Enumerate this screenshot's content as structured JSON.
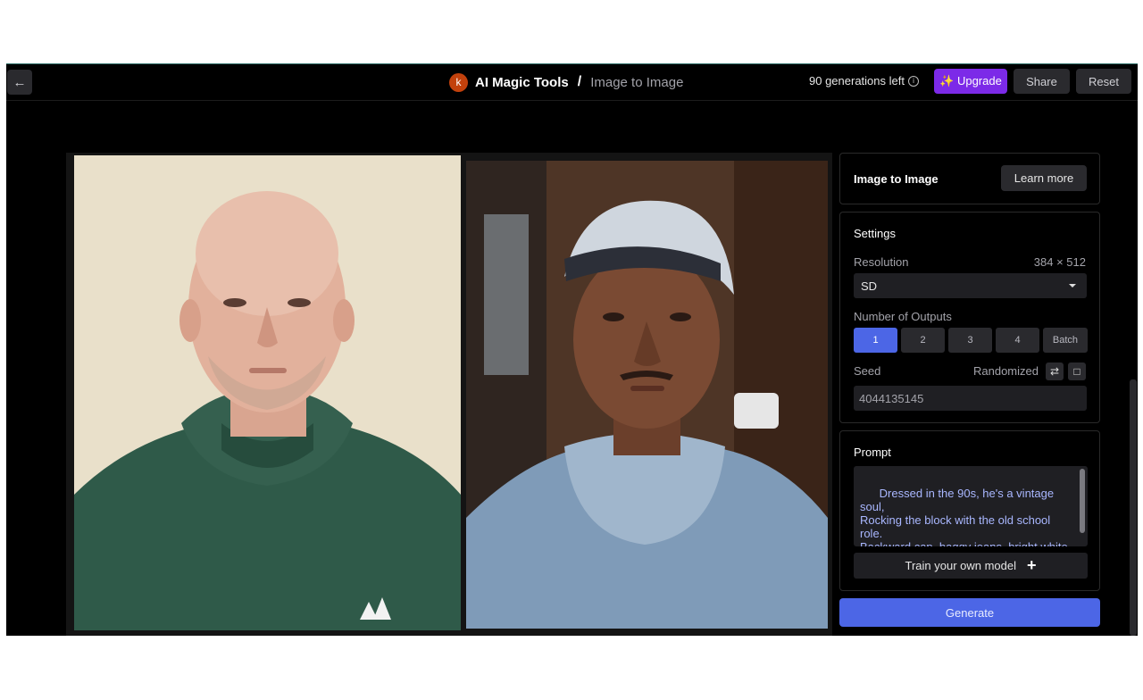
{
  "header": {
    "back_icon": "arrow-left-icon",
    "logo_letter": "k",
    "app_name": "AI Magic Tools",
    "separator": "/",
    "page_name": "Image to Image",
    "generations_left": "90 generations left",
    "info_icon": "ⓘ",
    "upgrade_label": "✨ Upgrade",
    "share_label": "Share",
    "reset_label": "Reset"
  },
  "intro_panel": {
    "title": "Image to Image",
    "learn_more_label": "Learn more"
  },
  "settings": {
    "title": "Settings",
    "resolution_label": "Resolution",
    "resolution_value": "384 × 512",
    "resolution_select": "SD",
    "outputs_label": "Number of Outputs",
    "outputs": [
      "1",
      "2",
      "3",
      "4",
      "Batch"
    ],
    "outputs_selected": "1",
    "seed_label": "Seed",
    "seed_mode": "Randomized",
    "seed_value": "4044135145",
    "shuffle_icon": "shuffle-icon",
    "clipboard_icon": "clipboard-icon"
  },
  "prompt_panel": {
    "title": "Prompt",
    "text": "Dressed in the 90s, he's a vintage soul,\nRocking the block with the old school role.\nBackward cap, baggy jeans, bright white kicks,\nOut there hustling his fly magic tricks.",
    "train_label": "Train your own model",
    "plus_icon": "+"
  },
  "generate_label": "Generate",
  "colors": {
    "accent": "#4c66e6",
    "upgrade": "#7c2ae8",
    "logo": "#c2410c"
  }
}
